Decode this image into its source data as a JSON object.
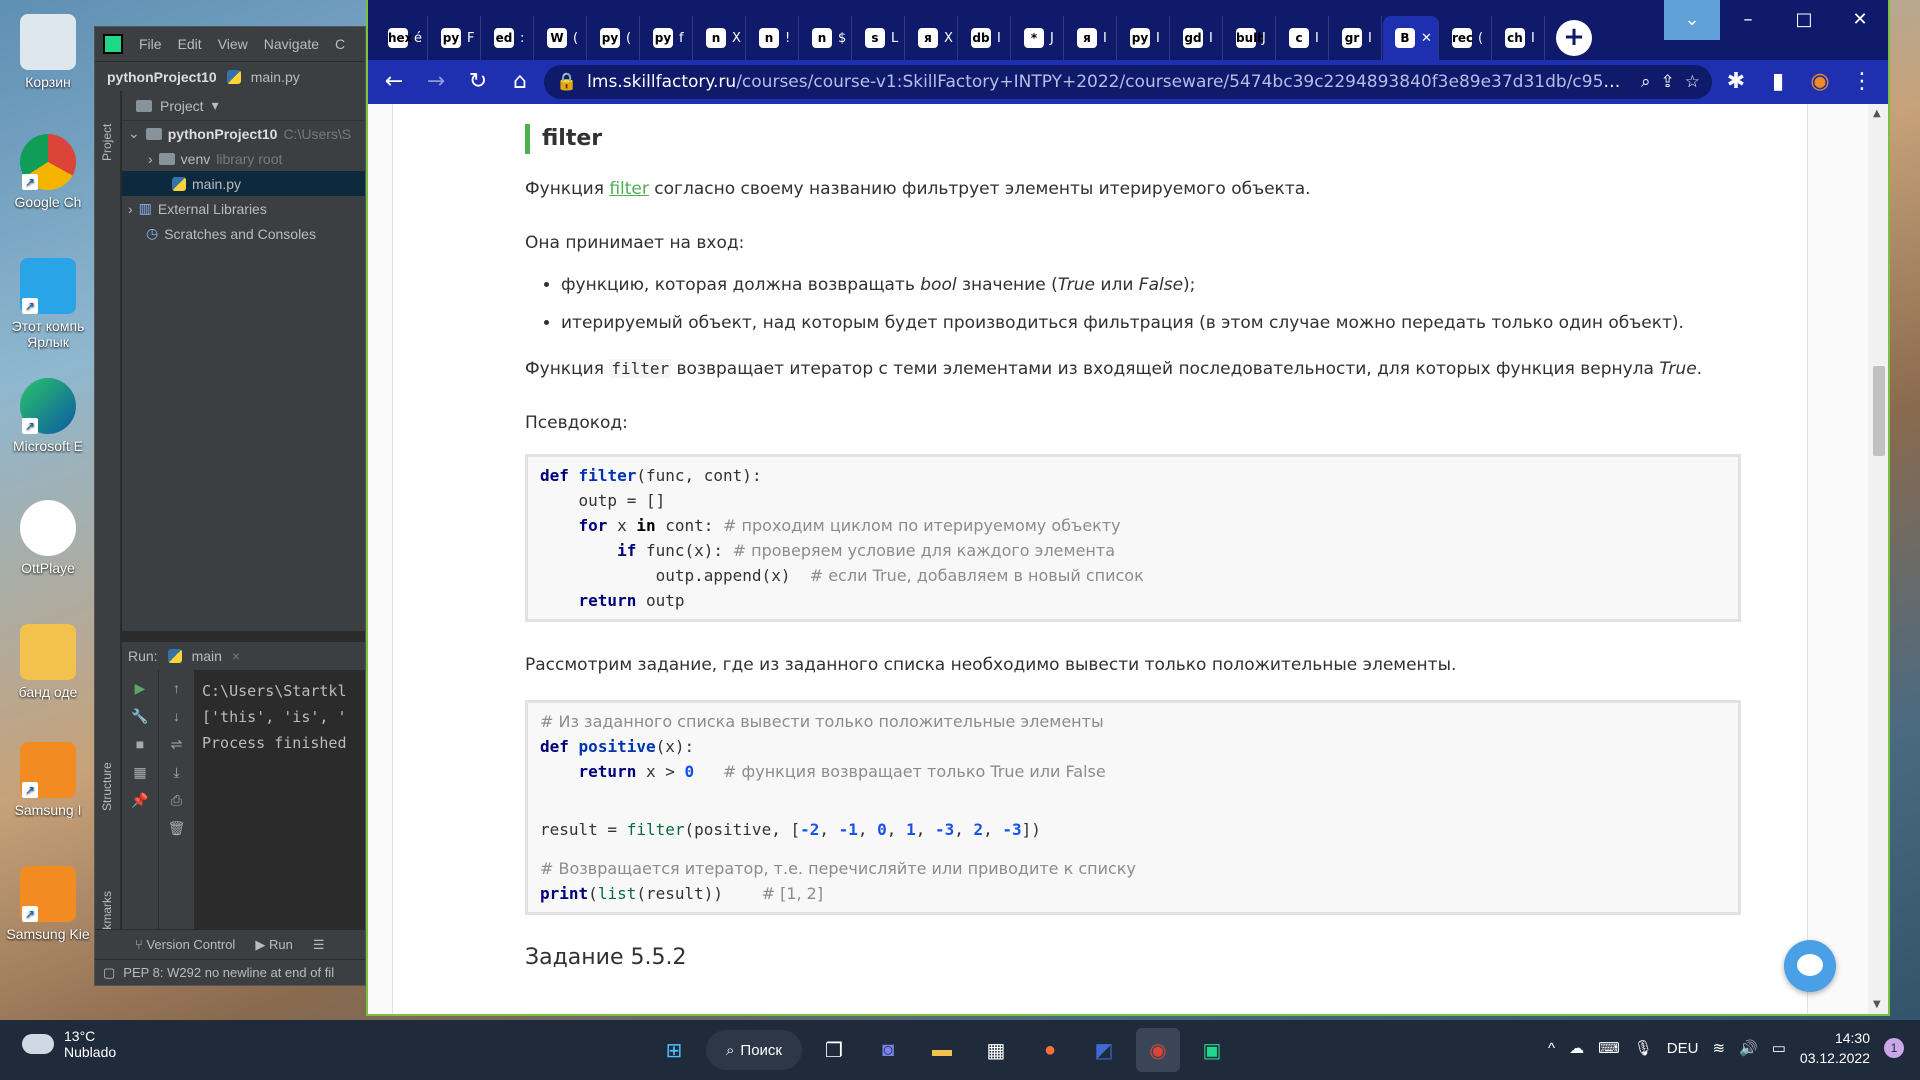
{
  "desktop": {
    "icons": [
      {
        "label": "Корзин"
      },
      {
        "label": "Google Ch"
      },
      {
        "label": "Этот компь"
      },
      {
        "label": "Ярлык"
      },
      {
        "label": "Microsoft E"
      },
      {
        "label": "OttPlaye"
      },
      {
        "label": "банд оде"
      },
      {
        "label": "Samsung I"
      },
      {
        "label": "Samsung Kie"
      }
    ]
  },
  "pycharm": {
    "menu": [
      "File",
      "Edit",
      "View",
      "Navigate",
      "C"
    ],
    "nav_project": "pythonProject10",
    "nav_file": "main.py",
    "project_label": "Project",
    "side_tabs": [
      "Project",
      "Structure",
      "Bookmarks"
    ],
    "tree": [
      {
        "label": "pythonProject10",
        "hint": "C:\\Users\\S"
      },
      {
        "label": "venv",
        "hint": "library root"
      },
      {
        "label": "main.py",
        "hint": ""
      },
      {
        "label": "External Libraries",
        "hint": ""
      },
      {
        "label": "Scratches and Consoles",
        "hint": ""
      }
    ],
    "run_label": "Run:",
    "run_tab": "main",
    "console": [
      "C:\\Users\\Startkl",
      "['this', 'is', '",
      "",
      "Process finished"
    ],
    "bottom_tabs": [
      "Version Control",
      "Run"
    ],
    "status": "PEP 8: W292 no newline at end of fil"
  },
  "chrome": {
    "tabs": [
      {
        "icon": "hex",
        "text": "é"
      },
      {
        "icon": "py",
        "text": "F"
      },
      {
        "icon": "ed",
        "text": ":"
      },
      {
        "icon": "W",
        "text": "("
      },
      {
        "icon": "py",
        "text": "("
      },
      {
        "icon": "py",
        "text": "f"
      },
      {
        "icon": "n",
        "text": "Х"
      },
      {
        "icon": "n",
        "text": "!"
      },
      {
        "icon": "n",
        "text": "$"
      },
      {
        "icon": "s",
        "text": "L"
      },
      {
        "icon": "я",
        "text": "Х"
      },
      {
        "icon": "db",
        "text": "I"
      },
      {
        "icon": "*",
        "text": "J"
      },
      {
        "icon": "я",
        "text": "I"
      },
      {
        "icon": "py",
        "text": "I"
      },
      {
        "icon": "gd",
        "text": "I"
      },
      {
        "icon": "bulb",
        "text": "J"
      },
      {
        "icon": "c",
        "text": "I"
      },
      {
        "icon": "gr",
        "text": "I"
      },
      {
        "icon": "B",
        "text": "✕",
        "active": true
      },
      {
        "icon": "rec",
        "text": "("
      },
      {
        "icon": "ch",
        "text": "I"
      }
    ],
    "url_host": "lms.skillfactory.ru",
    "url_path": "/courses/course-v1:SkillFactory+INTPY+2022/courseware/5474bc39c2294893840f3e89e37d31db/c9591776961...",
    "window_controls": [
      "⌄",
      "–",
      "□",
      "✕"
    ]
  },
  "article": {
    "heading": "filter",
    "p1_before": "Функция ",
    "p1_link": "filter",
    "p1_after": " согласно своему названию фильтрует элементы итерируемого объекта.",
    "p2": "Она принимает на вход:",
    "bullet1_a": "функцию, которая должна возвращать ",
    "bullet1_bool": "bool",
    "bullet1_b": " значение (",
    "bullet1_true": "True",
    "bullet1_c": " или ",
    "bullet1_false": "False",
    "bullet1_d": ");",
    "bullet2": "итерируемый объект, над которым будет производиться фильтрация (в этом случае можно передать только один объект).",
    "p3_before": "Функция ",
    "p3_code": "filter",
    "p3_after": " возвращает итератор с теми элементами из входящей последовательности, для которых функция вернула ",
    "p3_true": "True",
    "p3_end": ".",
    "p4": "Псевдокод:",
    "code1": {
      "l1_kw": "def",
      "l1_fn": "filter",
      "l1_rest": "(func, cont):",
      "l2": "    outp = []",
      "l3_kw": "for",
      "l3_a": " x ",
      "l3_in": "in",
      "l3_b": " cont: ",
      "l3_cm": "# проходим циклом по итерируемому объекту",
      "l4_kw": "if",
      "l4_b": " func(x): ",
      "l4_cm": "# проверяем условие для каждого элемента",
      "l5_a": "            outp.append(x)  ",
      "l5_cm": "# если True, добавляем в новый список",
      "l6_kw": "return",
      "l6_b": " outp"
    },
    "p5": "Рассмотрим задание, где из заданного списка необходимо вывести только положительные элементы.",
    "code2": {
      "c1": "# Из заданного списка вывести только положительные элементы",
      "l2_kw": "def",
      "l2_fn": "positive",
      "l2_rest": "(x):",
      "l3_kw": "return",
      "l3_a": " x > ",
      "l3_num": "0",
      "l3_cm": "# функция возвращает только True или False",
      "l5_a": "result = ",
      "l5_filter": "filter",
      "l5_b": "(positive, [",
      "nums": [
        "-2",
        "-1",
        "0",
        "1",
        "-3",
        "2",
        "-3"
      ],
      "l5_end": "])",
      "c7": "# Возвращается итератор, т.е. перечисляйте или приводите к списку",
      "l8_print": "print",
      "l8_b": "(",
      "l8_list": "list",
      "l8_c": "(result))",
      "l8_cm": "# [1, 2]"
    },
    "next_heading": "Задание 5.5.2"
  },
  "taskbar": {
    "temp": "13°C",
    "weather": "Nublado",
    "search": "Поиск",
    "lang": "DEU",
    "time": "14:30",
    "date": "03.12.2022",
    "notifications": "1"
  }
}
